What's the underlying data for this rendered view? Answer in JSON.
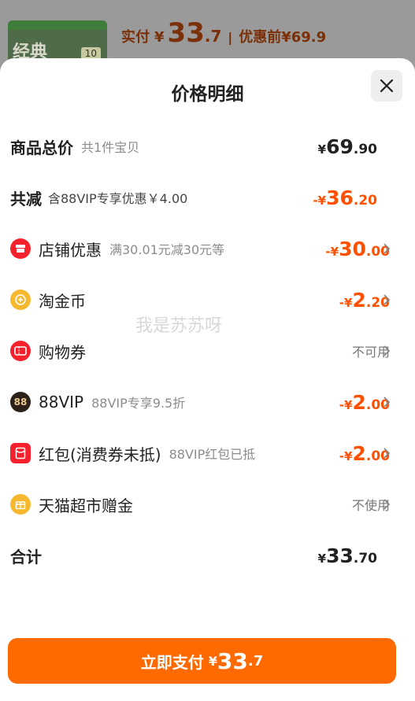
{
  "background": {
    "thumbnail_label": "经典",
    "thumbnail_tag": "10",
    "pay_label": "实付",
    "currency": "¥",
    "pay_int": "33",
    "pay_dec": ".7",
    "separator": "|",
    "original_label": "优惠前",
    "original_price": "¥69.9"
  },
  "sheet": {
    "title": "价格明细",
    "close_icon": "close-icon"
  },
  "rows": {
    "total": {
      "label": "商品总价",
      "sub": "共1件宝贝",
      "currency": "¥",
      "int": "69",
      "dec": ".90"
    },
    "discount_total": {
      "label": "共减",
      "sub": "含88VIP专享优惠￥4.00",
      "prefix": "-",
      "currency": "¥",
      "int": "36",
      "dec": ".20"
    },
    "store": {
      "icon": "store-coupon-icon",
      "label": "店铺优惠",
      "sub": "满30.01元减30元等",
      "prefix": "-",
      "currency": "¥",
      "int": "30",
      "dec": ".00"
    },
    "coins": {
      "icon": "taojinbi-coin-icon",
      "label": "淘金币",
      "prefix": "-",
      "currency": "¥",
      "int": "2",
      "dec": ".20"
    },
    "voucher": {
      "icon": "voucher-icon",
      "label": "购物券",
      "status": "不可用"
    },
    "vip": {
      "icon": "88vip-icon",
      "label": "88VIP",
      "sub": "88VIP专享9.5折",
      "prefix": "-",
      "currency": "¥",
      "int": "2",
      "dec": ".00"
    },
    "redpacket": {
      "icon": "red-packet-icon",
      "label": "红包(消费券未抵)",
      "sub": "88VIP红包已抵",
      "prefix": "-",
      "currency": "¥",
      "int": "2",
      "dec": ".00"
    },
    "tmall_gift": {
      "icon": "tmall-gift-icon",
      "label": "天猫超市赠金",
      "status": "不使用"
    },
    "sum": {
      "label": "合计",
      "currency": "¥",
      "int": "33",
      "dec": ".70"
    }
  },
  "watermark": "我是苏苏呀",
  "pay_button": {
    "label": "立即支付",
    "currency": "¥",
    "int": "33",
    "dec": ".7"
  },
  "colors": {
    "accent": "#ff5000",
    "button": "#ff6a00",
    "icon_red": "#f5222d",
    "icon_gold": "#f5b82e"
  }
}
